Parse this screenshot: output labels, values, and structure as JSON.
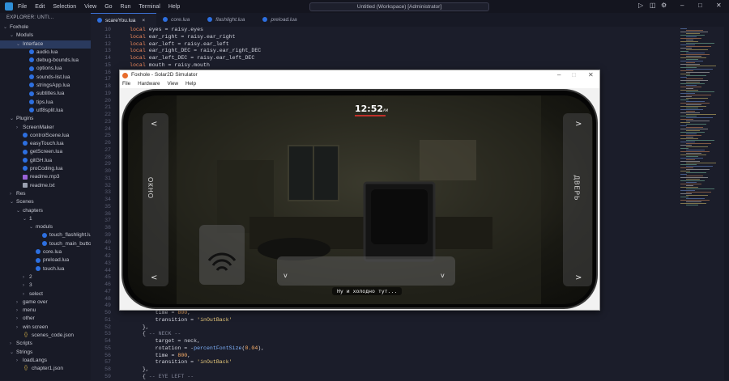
{
  "titlebar": {
    "menu": [
      "File",
      "Edit",
      "Selection",
      "View",
      "Go",
      "Run",
      "Terminal",
      "Help"
    ],
    "search": "Untitled (Workspace) [Administrator]"
  },
  "sidebar": {
    "header": "EXPLORER: UNTI...",
    "tree": [
      {
        "label": "Foxhole",
        "type": "folder",
        "depth": 0,
        "open": true
      },
      {
        "label": "Moduls",
        "type": "folder",
        "depth": 1,
        "open": true
      },
      {
        "label": "Interface",
        "type": "folder",
        "depth": 2,
        "open": true,
        "selected": true
      },
      {
        "label": "audio.lua",
        "type": "lua",
        "depth": 3
      },
      {
        "label": "debug-bounds.lua",
        "type": "lua",
        "depth": 3
      },
      {
        "label": "options.lua",
        "type": "lua",
        "depth": 3
      },
      {
        "label": "sounds-list.lua",
        "type": "lua",
        "depth": 3
      },
      {
        "label": "stringsApp.lua",
        "type": "lua",
        "depth": 3
      },
      {
        "label": "subtitles.lua",
        "type": "lua",
        "depth": 3
      },
      {
        "label": "tips.lua",
        "type": "lua",
        "depth": 3
      },
      {
        "label": "utf8split.lua",
        "type": "lua",
        "depth": 3
      },
      {
        "label": "Plugins",
        "type": "folder",
        "depth": 1,
        "open": true
      },
      {
        "label": "ScreenMaker",
        "type": "folder",
        "depth": 2,
        "open": false
      },
      {
        "label": "controlScene.lua",
        "type": "lua",
        "depth": 2
      },
      {
        "label": "easyTouch.lua",
        "type": "lua",
        "depth": 2
      },
      {
        "label": "getScreen.lua",
        "type": "lua",
        "depth": 2
      },
      {
        "label": "gitGH.lua",
        "type": "lua",
        "depth": 2
      },
      {
        "label": "proCoding.lua",
        "type": "lua",
        "depth": 2
      },
      {
        "label": "readme.mp3",
        "type": "mp3",
        "depth": 2
      },
      {
        "label": "readme.txt",
        "type": "txt",
        "depth": 2
      },
      {
        "label": "Res",
        "type": "folder",
        "depth": 1,
        "open": false
      },
      {
        "label": "Scenes",
        "type": "folder",
        "depth": 1,
        "open": true
      },
      {
        "label": "chapters",
        "type": "folder",
        "depth": 2,
        "open": true
      },
      {
        "label": "1",
        "type": "folder",
        "depth": 3,
        "open": true
      },
      {
        "label": "moduls",
        "type": "folder",
        "depth": 4,
        "open": true
      },
      {
        "label": "touch_flashlight.lua",
        "type": "lua",
        "depth": 5
      },
      {
        "label": "touch_main_button.lua",
        "type": "lua",
        "depth": 5
      },
      {
        "label": "core.lua",
        "type": "lua",
        "depth": 4
      },
      {
        "label": "preload.lua",
        "type": "lua",
        "depth": 4
      },
      {
        "label": "touch.lua",
        "type": "lua",
        "depth": 4
      },
      {
        "label": "2",
        "type": "folder",
        "depth": 3,
        "open": false
      },
      {
        "label": "3",
        "type": "folder",
        "depth": 3,
        "open": false
      },
      {
        "label": "select",
        "type": "folder",
        "depth": 3,
        "open": false
      },
      {
        "label": "game over",
        "type": "folder",
        "depth": 2,
        "open": false
      },
      {
        "label": "menu",
        "type": "folder",
        "depth": 2,
        "open": false
      },
      {
        "label": "other",
        "type": "folder",
        "depth": 2,
        "open": false
      },
      {
        "label": "win screen",
        "type": "folder",
        "depth": 2,
        "open": false
      },
      {
        "label": "scenes_code.json",
        "type": "json",
        "depth": 2
      },
      {
        "label": "Scripts",
        "type": "folder",
        "depth": 1,
        "open": false
      },
      {
        "label": "Strings",
        "type": "folder",
        "depth": 1,
        "open": true
      },
      {
        "label": "loadLangs",
        "type": "folder",
        "depth": 2,
        "open": false
      },
      {
        "label": "chapter1.json",
        "type": "json",
        "depth": 2
      }
    ]
  },
  "tabs": [
    {
      "label": "scareYou.lua",
      "active": true
    },
    {
      "label": "core.lua",
      "active": false
    },
    {
      "label": "flashlight.lua",
      "active": false
    },
    {
      "label": "preload.lua",
      "active": false
    }
  ],
  "editor": {
    "first_line": 10,
    "lines": [
      [
        [
          "k",
          "local "
        ],
        [
          "",
          "eyes = raisy.eyes"
        ]
      ],
      [
        [
          "k",
          "local "
        ],
        [
          "",
          "ear_right = raisy.ear_right"
        ]
      ],
      [
        [
          "k",
          "local "
        ],
        [
          "",
          "ear_left = raisy.ear_left"
        ]
      ],
      [
        [
          "k",
          "local "
        ],
        [
          "",
          "ear_right_DEC = raisy.ear_right_DEC"
        ]
      ],
      [
        [
          "k",
          "local "
        ],
        [
          "",
          "ear_left_DEC = raisy.ear_left_DEC"
        ]
      ],
      [
        [
          "k",
          "local "
        ],
        [
          "",
          "mouth = raisy.mouth"
        ]
      ],
      [],
      [],
      [],
      [],
      [],
      [],
      [],
      [],
      [],
      [],
      [],
      [],
      [],
      [],
      [],
      [],
      [],
      [],
      [],
      [],
      [],
      [],
      [],
      [],
      [],
      [],
      [],
      [],
      [],
      [],
      [],
      [],
      [],
      [],
      [
        [
          "",
          "        time = "
        ],
        [
          "n",
          "800"
        ],
        [
          "",
          ","
        ]
      ],
      [
        [
          "",
          "        transition = "
        ],
        [
          "s",
          "'inOutBack'"
        ]
      ],
      [
        [
          "",
          "    },"
        ]
      ],
      [
        [
          "",
          "    { "
        ],
        [
          "c",
          "-- NECK --"
        ]
      ],
      [
        [
          "",
          "        target = neck,"
        ]
      ],
      [
        [
          "",
          "        rotation = -"
        ],
        [
          "f",
          "percentFontSize"
        ],
        [
          "",
          "("
        ],
        [
          "n",
          "0.04"
        ],
        [
          "",
          "),"
        ]
      ],
      [
        [
          "",
          "        time = "
        ],
        [
          "n",
          "800"
        ],
        [
          "",
          ","
        ]
      ],
      [
        [
          "",
          "        transition = "
        ],
        [
          "s",
          "'inOutBack'"
        ]
      ],
      [
        [
          "",
          "    },"
        ]
      ],
      [
        [
          "",
          "    { "
        ],
        [
          "c",
          "-- EYE LEFT --"
        ]
      ]
    ]
  },
  "simulator": {
    "title": "Foxhole - Solar2D Simulator",
    "menu": [
      "File",
      "Hardware",
      "View",
      "Help"
    ],
    "clock": "12:52",
    "clock_suffix": "AM",
    "left_label": "ОКНО",
    "right_label": "ДВЕРЬ",
    "subtitle": "Ну и холодно тут...",
    "arrow_left": "<",
    "arrow_right": ">",
    "arrow_down": "v"
  }
}
